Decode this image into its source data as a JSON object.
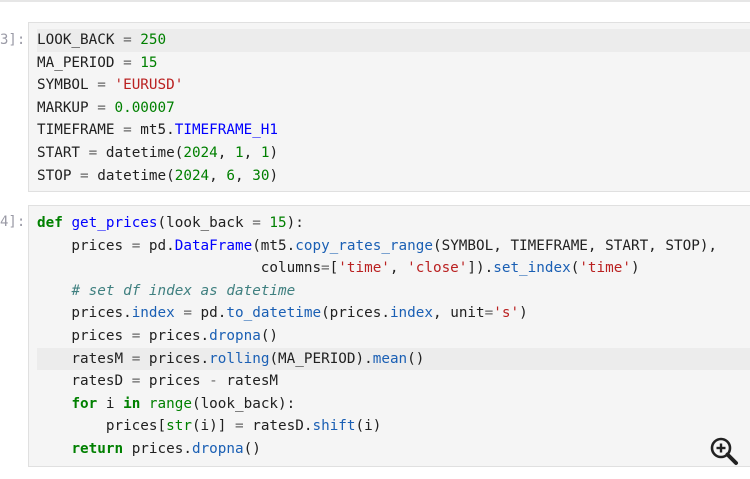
{
  "cell1": {
    "prompt": "3]:",
    "lines": [
      "LOOK_BACK = 250",
      "MA_PERIOD = 15",
      "SYMBOL = 'EURUSD'",
      "MARKUP = 0.00007",
      "TIMEFRAME = mt5.TIMEFRAME_H1",
      "START = datetime(2024, 1, 1)",
      "STOP = datetime(2024, 6, 30)"
    ]
  },
  "cell2": {
    "prompt": "4]:",
    "lines": [
      "def get_prices(look_back = 15):",
      "    prices = pd.DataFrame(mt5.copy_rates_range(SYMBOL, TIMEFRAME, START, STOP),",
      "                          columns=['time', 'close']).set_index('time')",
      "    # set df index as datetime",
      "    prices.index = pd.to_datetime(prices.index, unit='s')",
      "    prices = prices.dropna()",
      "    ratesM = prices.rolling(MA_PERIOD).mean()",
      "    ratesD = prices - ratesM",
      "    for i in range(look_back):",
      "        prices[str(i)] = ratesD.shift(i)",
      "    return prices.dropna()"
    ]
  },
  "icons": {
    "zoom": "zoom-in-icon"
  },
  "colors": {
    "cell_bg": "#f5f5f5",
    "keyword": "#008000",
    "string": "#ba2121",
    "function": "#0000ff",
    "comment": "#408080"
  }
}
